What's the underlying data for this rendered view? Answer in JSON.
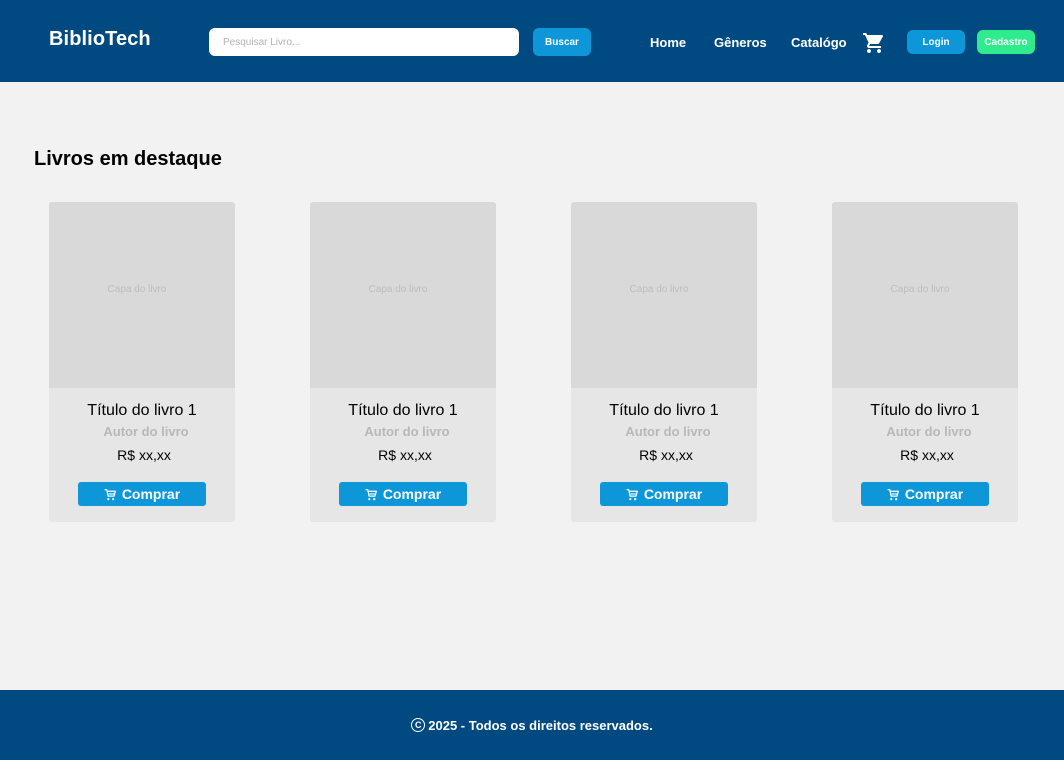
{
  "header": {
    "logo": "BiblioTech",
    "search": {
      "placeholder": "Pesquisar Livro...",
      "value": ""
    },
    "search_button": "Buscar",
    "nav": [
      {
        "label": "Home"
      },
      {
        "label": "Gêneros"
      },
      {
        "label": "Catalógo"
      }
    ],
    "cart_icon": "shopping-cart-icon",
    "login_button": "Login",
    "signup_button": "Cadastro"
  },
  "main": {
    "section_title": "Livros em destaque",
    "books": [
      {
        "cover_label": "Capa do livro",
        "title": "Título do livro 1",
        "author": "Autor do livro",
        "price": "R$ xx,xx",
        "buy_label": "Comprar"
      },
      {
        "cover_label": "Capa do livro",
        "title": "Título do livro 1",
        "author": "Autor do livro",
        "price": "R$ xx,xx",
        "buy_label": "Comprar"
      },
      {
        "cover_label": "Capa do livro",
        "title": "Título do livro 1",
        "author": "Autor do livro",
        "price": "R$ xx,xx",
        "buy_label": "Comprar"
      },
      {
        "cover_label": "Capa do livro",
        "title": "Título do livro 1",
        "author": "Autor do livro",
        "price": "R$ xx,xx",
        "buy_label": "Comprar"
      }
    ]
  },
  "footer": {
    "copyright_symbol": "C",
    "text": "2025 - Todos os direitos reservados."
  },
  "colors": {
    "header_bg": "#004a81",
    "primary_button": "#0d97d8",
    "signup_button": "#2eeb8d",
    "page_bg": "#f2f2f2",
    "card_bg": "#e6e6e6",
    "cover_bg": "#d9d9d9"
  }
}
